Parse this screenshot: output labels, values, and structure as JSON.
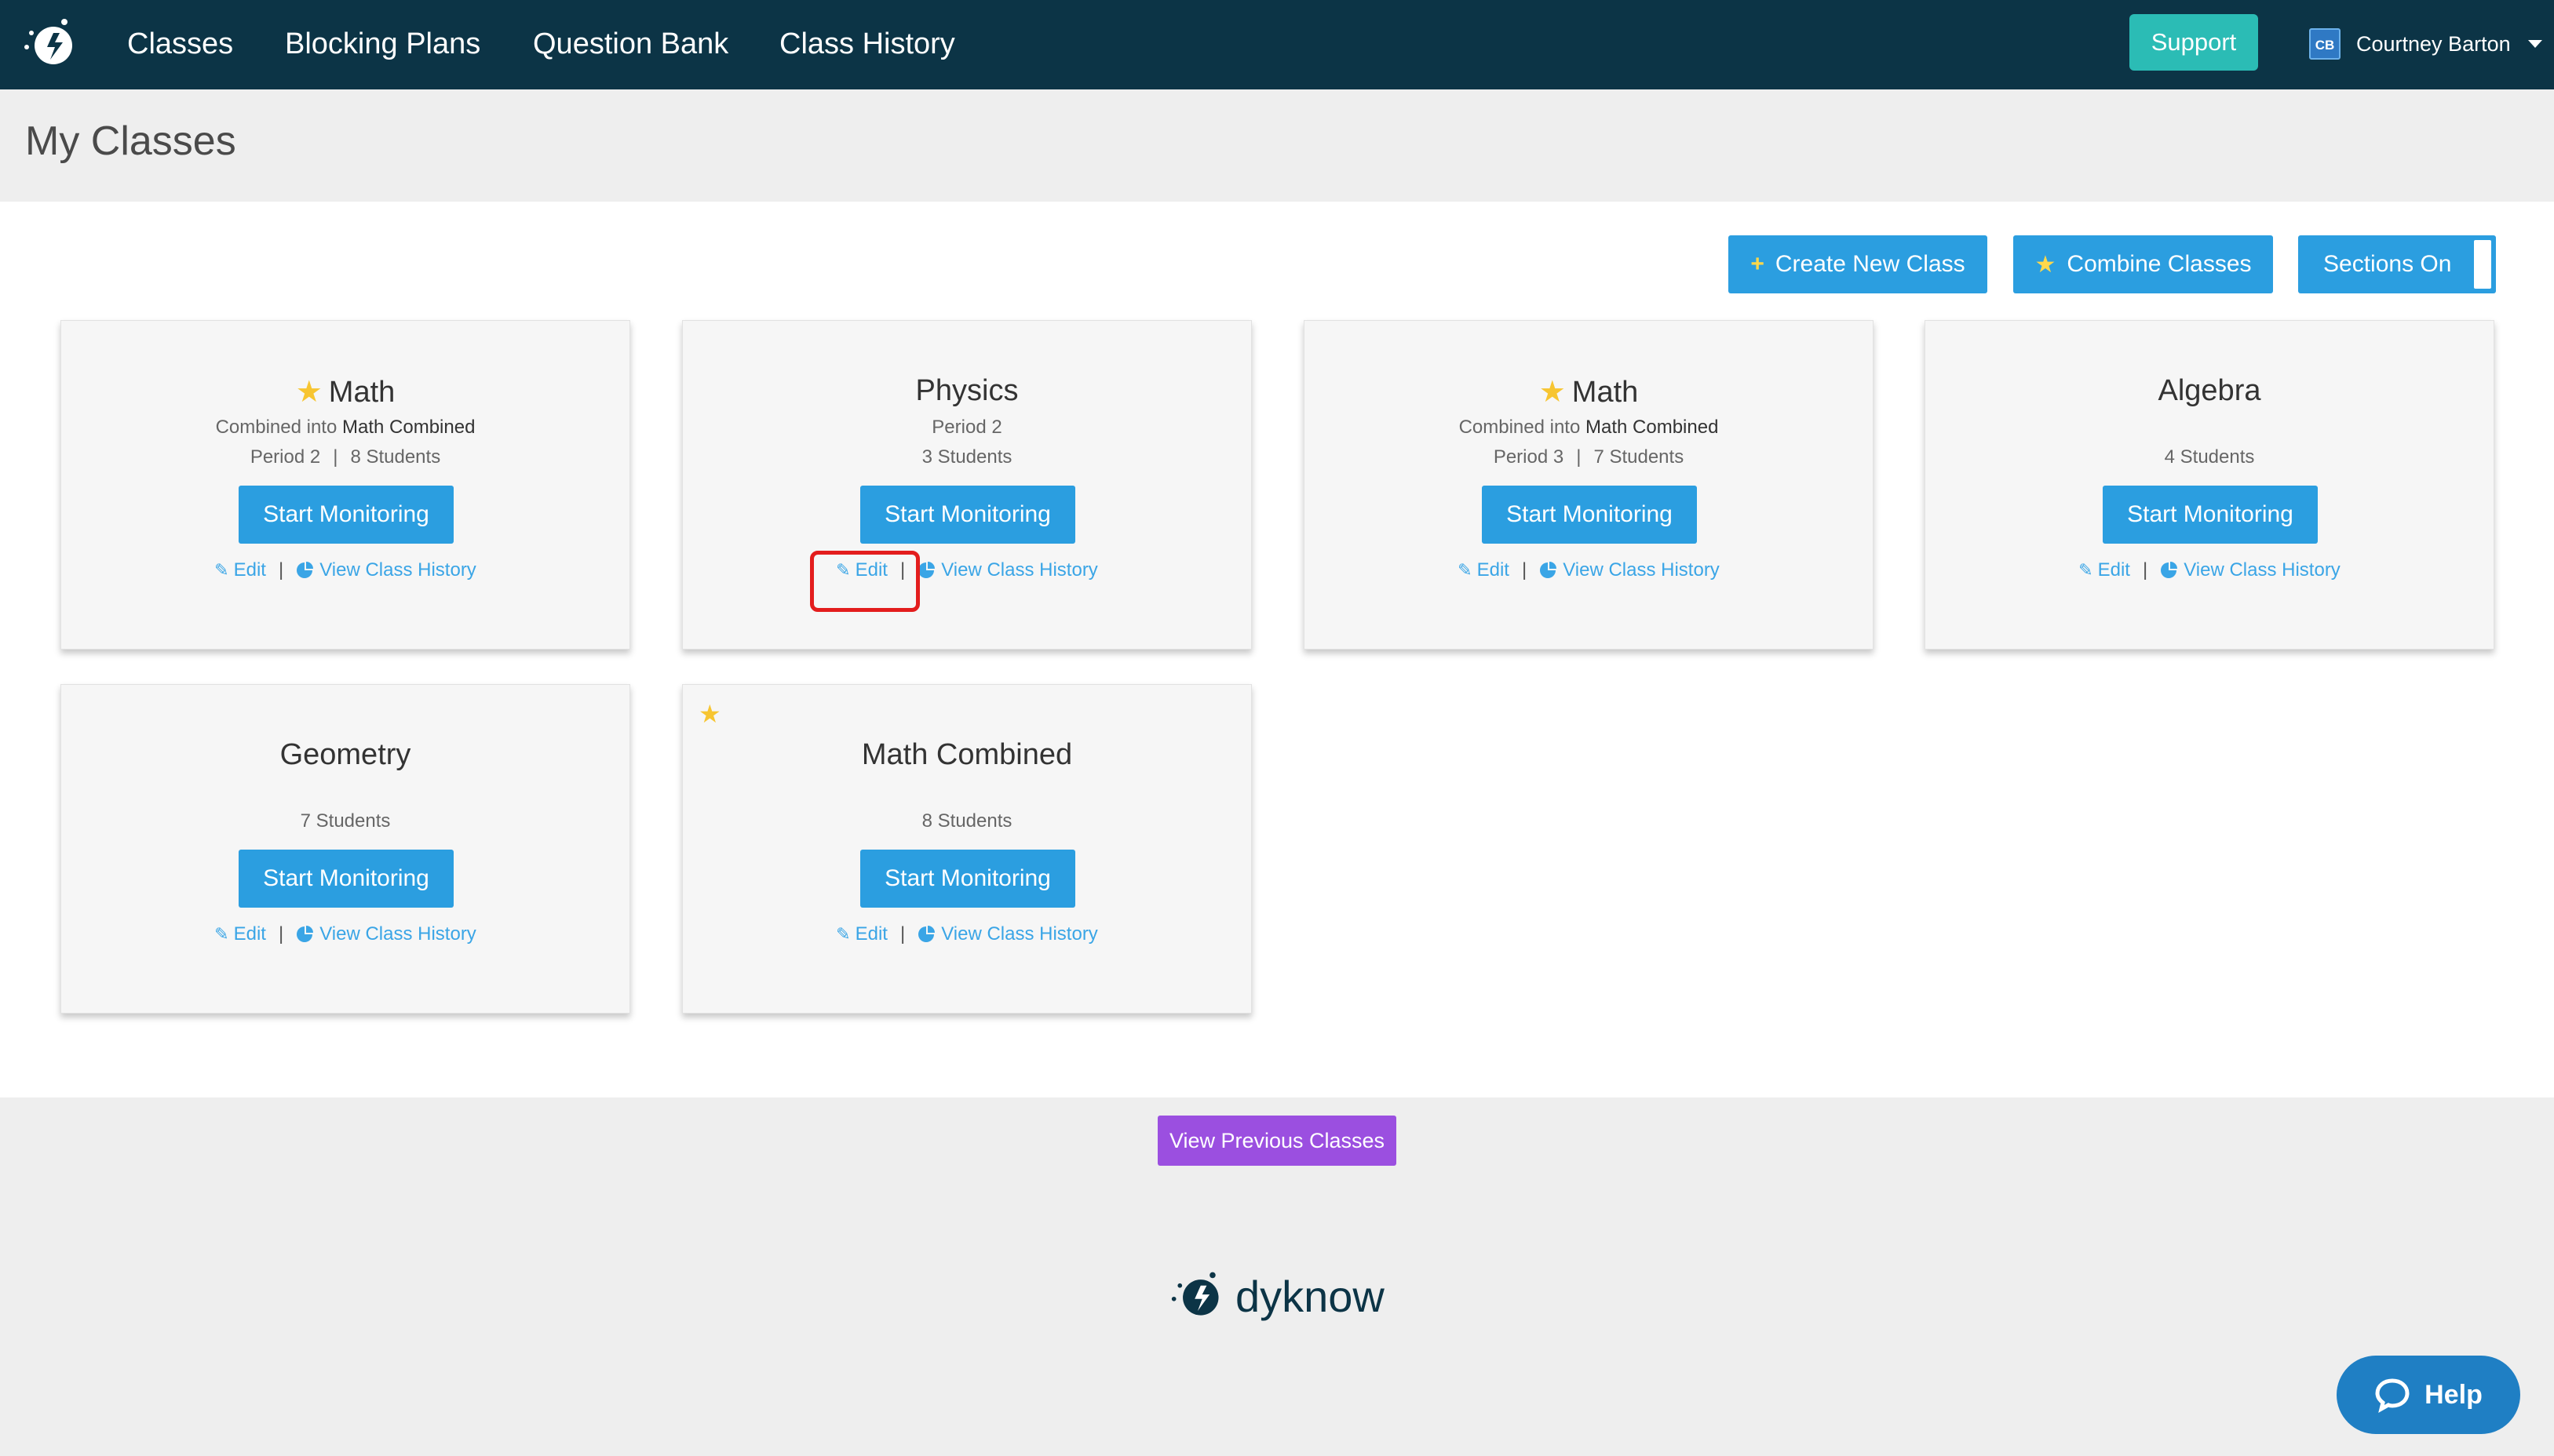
{
  "nav": {
    "links": [
      "Classes",
      "Blocking Plans",
      "Question Bank",
      "Class History"
    ],
    "support_label": "Support",
    "user_initials": "CB",
    "user_name": "Courtney Barton"
  },
  "page": {
    "title": "My Classes"
  },
  "toolbar": {
    "create_label": "Create New Class",
    "combine_label": "Combine Classes",
    "sections_label": "Sections On"
  },
  "classes": [
    {
      "name": "Math",
      "starred": true,
      "combined_prefix": "Combined into ",
      "combined_into": "Math Combined",
      "period": "Period 2",
      "students": "8 Students"
    },
    {
      "name": "Physics",
      "starred": false,
      "period": "Period 2",
      "students": "3 Students"
    },
    {
      "name": "Math",
      "starred": true,
      "combined_prefix": "Combined into ",
      "combined_into": "Math Combined",
      "period": "Period 3",
      "students": "7 Students"
    },
    {
      "name": "Algebra",
      "starred": false,
      "students": "4 Students"
    },
    {
      "name": "Geometry",
      "starred": false,
      "students": "7 Students"
    },
    {
      "name": "Math Combined",
      "starred": true,
      "students": "8 Students"
    }
  ],
  "card_actions": {
    "start_label": "Start Monitoring",
    "edit_label": "Edit",
    "history_label": "View Class History",
    "separator": "|"
  },
  "footer": {
    "previous_label": "View Previous Classes",
    "brand": "dyknow"
  },
  "help": {
    "label": "Help"
  },
  "colors": {
    "nav_bg": "#0c3446",
    "primary": "#2b9ee0",
    "support": "#2bbcb5",
    "star": "#f7c531",
    "previous": "#9b4fe0",
    "highlight": "#e31d1d"
  }
}
